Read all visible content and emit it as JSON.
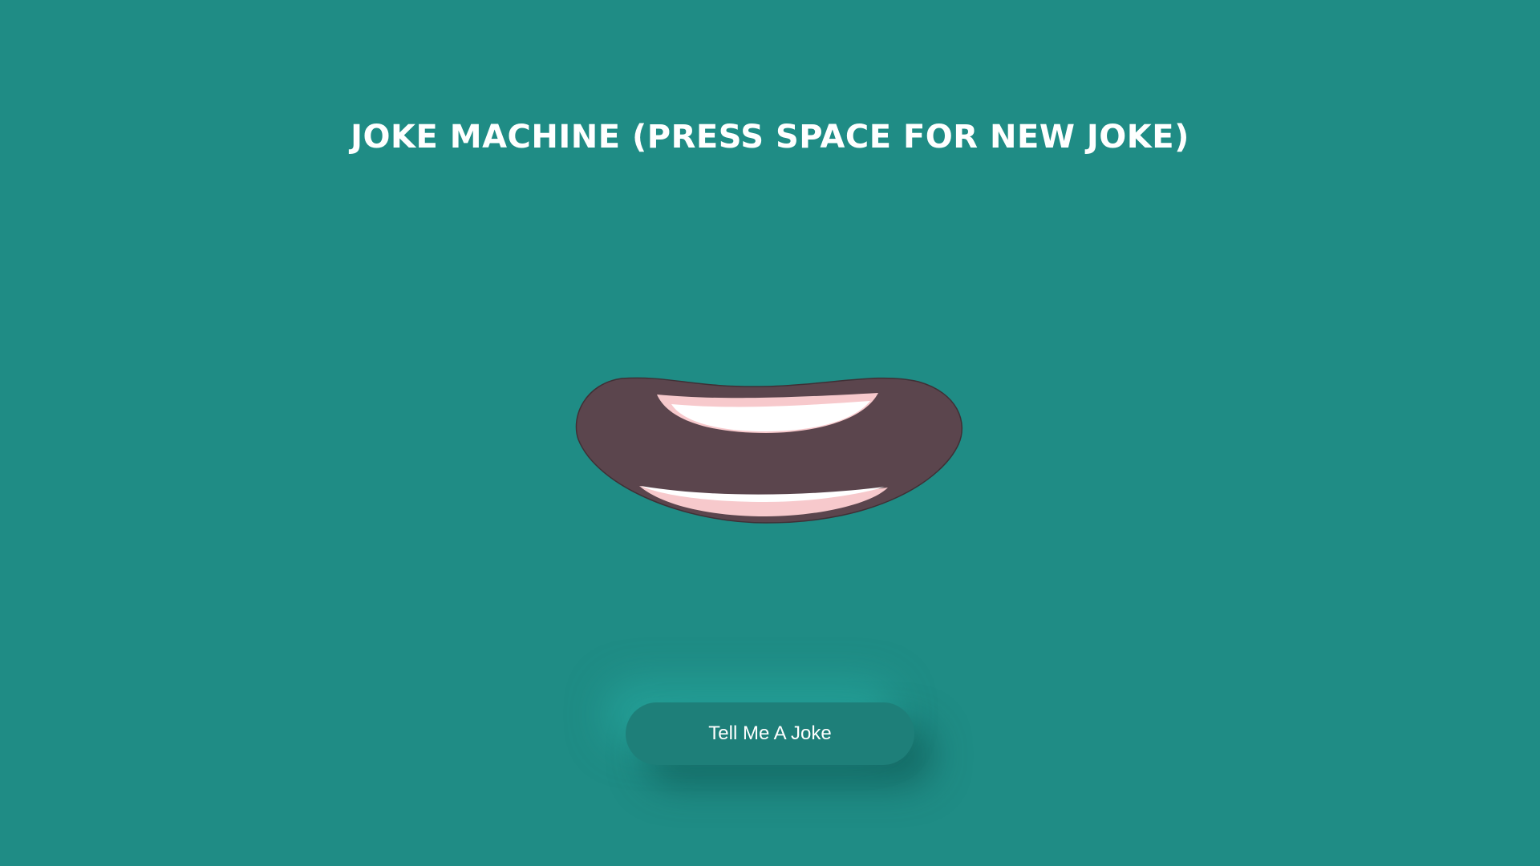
{
  "page": {
    "title": "JOKE MACHINE (PRESS SPACE FOR NEW JOKE)",
    "background_color": "#1f8c85"
  },
  "mouth": {
    "icon": "mouth-icon",
    "lip_color": "#5b454d",
    "teeth_color": "#ffffff",
    "gum_color": "#f7c9cc"
  },
  "button": {
    "label": "Tell Me A Joke",
    "color": "#1e7f79"
  }
}
